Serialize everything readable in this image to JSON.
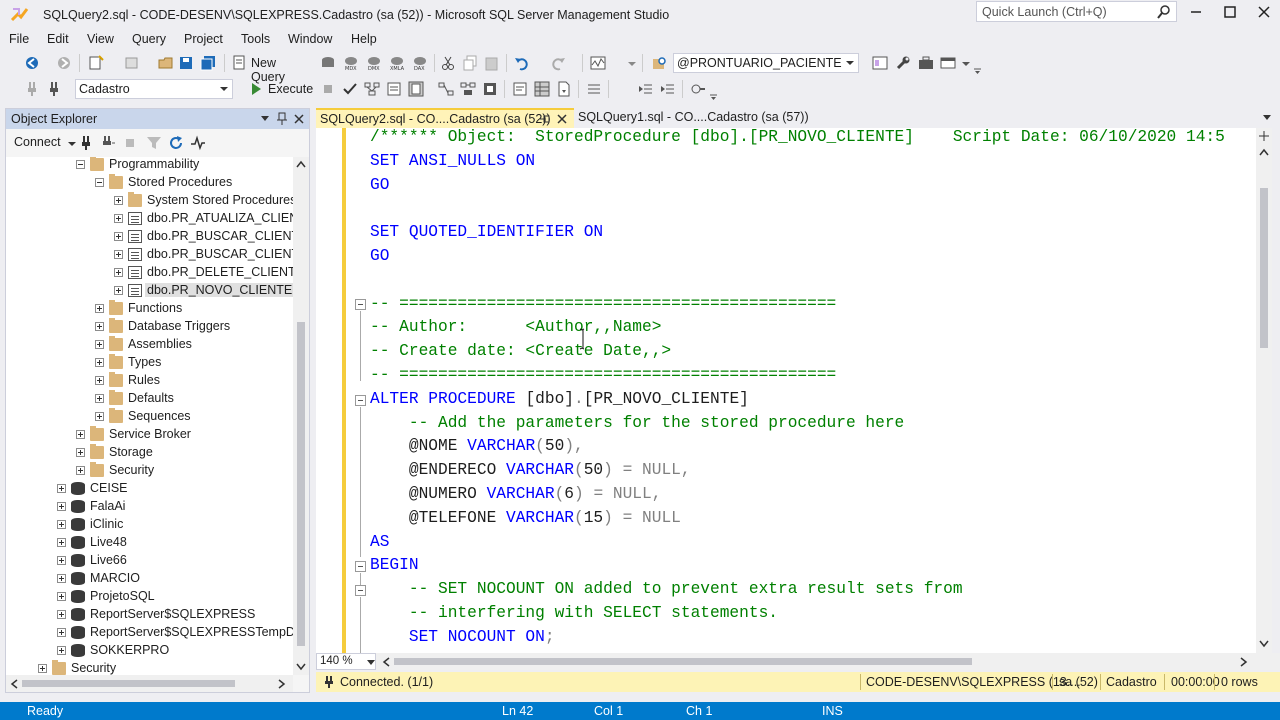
{
  "window": {
    "title": "SQLQuery2.sql - CODE-DESENV\\SQLEXPRESS.Cadastro (sa (52)) - Microsoft SQL Server Management Studio",
    "quick_launch_placeholder": "Quick Launch (Ctrl+Q)"
  },
  "menu": [
    "File",
    "Edit",
    "View",
    "Query",
    "Project",
    "Tools",
    "Window",
    "Help"
  ],
  "toolbar": {
    "new_query": "New Query",
    "object_combo": "@PRONTUARIO_PACIENTE",
    "database_combo": "Cadastro",
    "execute": "Execute"
  },
  "object_explorer": {
    "title": "Object Explorer",
    "connect": "Connect",
    "tree": [
      {
        "label": "Programmability",
        "icon": "folder",
        "expander": "minus"
      },
      {
        "label": "Stored Procedures",
        "icon": "folder",
        "expander": "minus"
      },
      {
        "label": "System Stored Procedures",
        "icon": "folder",
        "expander": "plus"
      },
      {
        "label": "dbo.PR_ATUALIZA_CLIENTE",
        "icon": "stored-procedure",
        "expander": "plus"
      },
      {
        "label": "dbo.PR_BUSCAR_CLIENTE",
        "icon": "stored-procedure",
        "expander": "plus"
      },
      {
        "label": "dbo.PR_BUSCAR_CLIENTES",
        "icon": "stored-procedure",
        "expander": "plus"
      },
      {
        "label": "dbo.PR_DELETE_CLIENTE",
        "icon": "stored-procedure",
        "expander": "plus"
      },
      {
        "label": "dbo.PR_NOVO_CLIENTE",
        "icon": "stored-procedure",
        "expander": "plus"
      },
      {
        "label": "Functions",
        "icon": "folder",
        "expander": "plus"
      },
      {
        "label": "Database Triggers",
        "icon": "folder",
        "expander": "plus"
      },
      {
        "label": "Assemblies",
        "icon": "folder",
        "expander": "plus"
      },
      {
        "label": "Types",
        "icon": "folder",
        "expander": "plus"
      },
      {
        "label": "Rules",
        "icon": "folder",
        "expander": "plus"
      },
      {
        "label": "Defaults",
        "icon": "folder",
        "expander": "plus"
      },
      {
        "label": "Sequences",
        "icon": "folder",
        "expander": "plus"
      },
      {
        "label": "Service Broker",
        "icon": "folder",
        "expander": "plus"
      },
      {
        "label": "Storage",
        "icon": "folder",
        "expander": "plus"
      },
      {
        "label": "Security",
        "icon": "folder",
        "expander": "plus"
      },
      {
        "label": "CEISE",
        "icon": "database",
        "expander": "plus"
      },
      {
        "label": "FalaAi",
        "icon": "database",
        "expander": "plus"
      },
      {
        "label": "iClinic",
        "icon": "database",
        "expander": "plus"
      },
      {
        "label": "Live48",
        "icon": "database",
        "expander": "plus"
      },
      {
        "label": "Live66",
        "icon": "database",
        "expander": "plus"
      },
      {
        "label": "MARCIO",
        "icon": "database",
        "expander": "plus"
      },
      {
        "label": "ProjetoSQL",
        "icon": "database",
        "expander": "plus"
      },
      {
        "label": "ReportServer$SQLEXPRESS",
        "icon": "database",
        "expander": "plus"
      },
      {
        "label": "ReportServer$SQLEXPRESSTempDB",
        "icon": "database",
        "expander": "plus"
      },
      {
        "label": "SOKKERPRO",
        "icon": "database",
        "expander": "plus"
      },
      {
        "label": "Security",
        "icon": "folder",
        "expander": "plus"
      }
    ]
  },
  "tabs": [
    {
      "label": "SQLQuery2.sql - CO....Cadastro (sa (52))",
      "active": true
    },
    {
      "label": "SQLQuery1.sql - CO....Cadastro (sa (57))",
      "active": false
    }
  ],
  "editor": {
    "lines": [
      [
        {
          "t": "/****** Object:  StoredProcedure [dbo].[PR_NOVO_CLIENTE]    Script Date: 06/10/2020 14:5",
          "c": "cm"
        }
      ],
      [
        {
          "t": "SET ANSI_NULLS ON",
          "c": "kw"
        }
      ],
      [
        {
          "t": "GO",
          "c": "kw"
        }
      ],
      [],
      [
        {
          "t": "SET QUOTED_IDENTIFIER ON",
          "c": "kw"
        }
      ],
      [
        {
          "t": "GO",
          "c": "kw"
        }
      ],
      [],
      [
        {
          "t": "-- =============================================",
          "c": "cm"
        }
      ],
      [
        {
          "t": "-- Author:      <Author,,Name>",
          "c": "cm"
        }
      ],
      [
        {
          "t": "-- Create date: <Create Date,,>",
          "c": "cm"
        }
      ],
      [
        {
          "t": "-- =============================================",
          "c": "cm"
        }
      ],
      [
        {
          "t": "ALTER PROCEDURE ",
          "c": "kw"
        },
        {
          "t": "[dbo]",
          "c": "pl"
        },
        {
          "t": ".",
          "c": "gy"
        },
        {
          "t": "[PR_NOVO_CLIENTE]",
          "c": "pl"
        }
      ],
      [
        {
          "t": "    -- Add the parameters for the stored procedure here",
          "c": "cm"
        }
      ],
      [
        {
          "t": "    @NOME ",
          "c": "pl"
        },
        {
          "t": "VARCHAR",
          "c": "kw"
        },
        {
          "t": "(",
          "c": "gy"
        },
        {
          "t": "50",
          "c": "pl"
        },
        {
          "t": "),",
          "c": "gy"
        }
      ],
      [
        {
          "t": "    @ENDERECO ",
          "c": "pl"
        },
        {
          "t": "VARCHAR",
          "c": "kw"
        },
        {
          "t": "(",
          "c": "gy"
        },
        {
          "t": "50",
          "c": "pl"
        },
        {
          "t": ") = NULL,",
          "c": "gy"
        }
      ],
      [
        {
          "t": "    @NUMERO ",
          "c": "pl"
        },
        {
          "t": "VARCHAR",
          "c": "kw"
        },
        {
          "t": "(",
          "c": "gy"
        },
        {
          "t": "6",
          "c": "pl"
        },
        {
          "t": ") = NULL,",
          "c": "gy"
        }
      ],
      [
        {
          "t": "    @TELEFONE ",
          "c": "pl"
        },
        {
          "t": "VARCHAR",
          "c": "kw"
        },
        {
          "t": "(",
          "c": "gy"
        },
        {
          "t": "15",
          "c": "pl"
        },
        {
          "t": ") = NULL",
          "c": "gy"
        }
      ],
      [
        {
          "t": "AS",
          "c": "kw"
        }
      ],
      [
        {
          "t": "BEGIN",
          "c": "kw"
        }
      ],
      [
        {
          "t": "    -- SET NOCOUNT ON added to prevent extra result sets from",
          "c": "cm"
        }
      ],
      [
        {
          "t": "    -- interfering with SELECT statements.",
          "c": "cm"
        }
      ],
      [
        {
          "t": "    SET NOCOUNT ON",
          "c": "kw"
        },
        {
          "t": ";",
          "c": "gy"
        }
      ]
    ],
    "zoom": "140 %"
  },
  "query_status": {
    "message": "Connected. (1/1)",
    "server": "CODE-DESENV\\SQLEXPRESS (13....",
    "user": "sa (52)",
    "database": "Cadastro",
    "elapsed": "00:00:00",
    "rows": "0 rows"
  },
  "statusbar": {
    "state": "Ready",
    "ln": "Ln 42",
    "col": "Col 1",
    "ch": "Ch 1",
    "mode": "INS"
  },
  "colors": {
    "accent": "#007acc",
    "keyword": "#0000ff",
    "comment": "#008000",
    "active_tab": "#fff3b8"
  }
}
